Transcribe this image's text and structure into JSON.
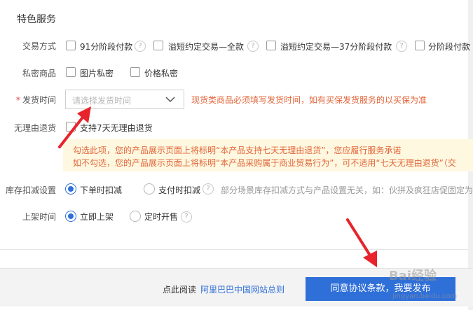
{
  "section_title": "特色服务",
  "trade_method": {
    "label": "交易方式",
    "options": [
      {
        "label": "91分阶段付款"
      },
      {
        "label": "溢短约定交易—全款"
      },
      {
        "label": "溢短约定交易—37分阶段付款"
      },
      {
        "label": "分阶段付款"
      }
    ]
  },
  "private_goods": {
    "label": "私密商品",
    "options": [
      {
        "label": "图片私密"
      },
      {
        "label": "价格私密"
      }
    ]
  },
  "ship_time": {
    "required_mark": "*",
    "label": "发货时间",
    "placeholder": "请选择发货时间",
    "hint": "现货类商品必须填写发货时间，如有买保发货服务的以买保为准"
  },
  "no_reason_return": {
    "label": "无理由退货",
    "option": "支持7天无理由退货",
    "notice_line1": "勾选此项，您的产品展示页面上将标明“本产品支持七天无理由退货”，您应履行服务承诺",
    "notice_line2": "如不勾选，您的产品展示页面上将标明“本产品采购属于商业贸易行为”，可不适用“七天无理由退货”（交"
  },
  "stock_deduct": {
    "label": "库存扣减设置",
    "options": [
      {
        "label": "下单时扣减",
        "selected": true
      },
      {
        "label": "支付时扣减",
        "selected": false
      }
    ],
    "hint": "部分场景库存扣减方式与产品设置无关，如：伙拼及疯狂店促固定为"
  },
  "listing_time": {
    "label": "上架时间",
    "options": [
      {
        "label": "立即上架",
        "selected": true
      },
      {
        "label": "定时开售",
        "selected": false
      }
    ]
  },
  "footer": {
    "read_text": "点此阅读",
    "rules_link": "阿里巴巴中国网站总则",
    "submit_label": "同意协议条款，我要发布"
  },
  "watermark": {
    "brand": "Bai经验",
    "url": "jingyan.baidu.com"
  },
  "help_glyph": "?",
  "colors": {
    "accent": "#2f6fd8",
    "warning_text": "#e2653a",
    "notice_bg": "#fff8e0",
    "annotation_arrow": "#e8232b"
  }
}
